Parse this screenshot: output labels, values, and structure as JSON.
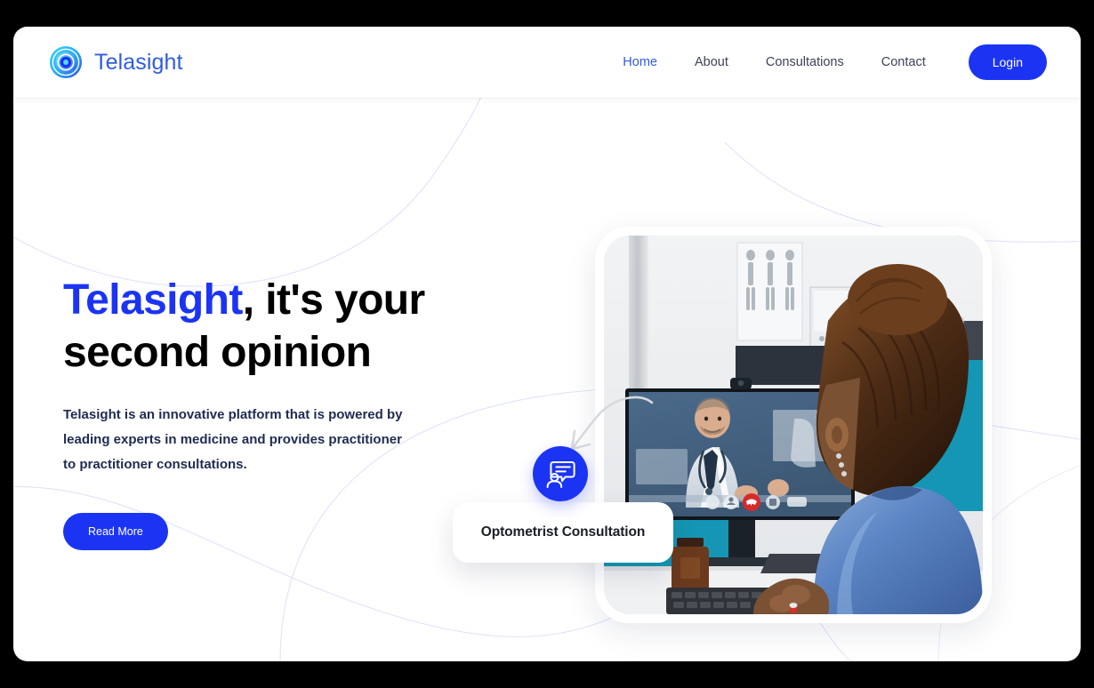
{
  "brand": {
    "name": "Telasight",
    "logo_icon": "concentric-eye-icon",
    "logo_color_outer": "#2fc6f0",
    "logo_color_inner": "#1b34f4"
  },
  "nav": {
    "items": [
      {
        "label": "Home",
        "active": true
      },
      {
        "label": "About",
        "active": false
      },
      {
        "label": "Consultations",
        "active": false
      },
      {
        "label": "Contact",
        "active": false
      }
    ],
    "login_label": "Login",
    "login_color": "#1b34f4"
  },
  "hero": {
    "headline_accent": "Telasight",
    "headline_rest": ", it's your second opinion",
    "paragraph": "Telasight is an innovative platform that is powered by leading experts in medicine and provides practitioner to practitioner consultations.",
    "cta_label": "Read More",
    "cta_color": "#1b34f4"
  },
  "floating_card": {
    "label": "Optometrist Consultation",
    "badge_icon": "consultation-speech-person-icon",
    "badge_color": "#1b34f4",
    "arrow_icon": "curved-arrow-icon"
  },
  "photo": {
    "alt": "Nurse in blue scrubs at a desk having a video consultation with a doctor on a monitor",
    "accent_teal": "#1496b4",
    "scrubs_blue": "#4e79b8"
  }
}
